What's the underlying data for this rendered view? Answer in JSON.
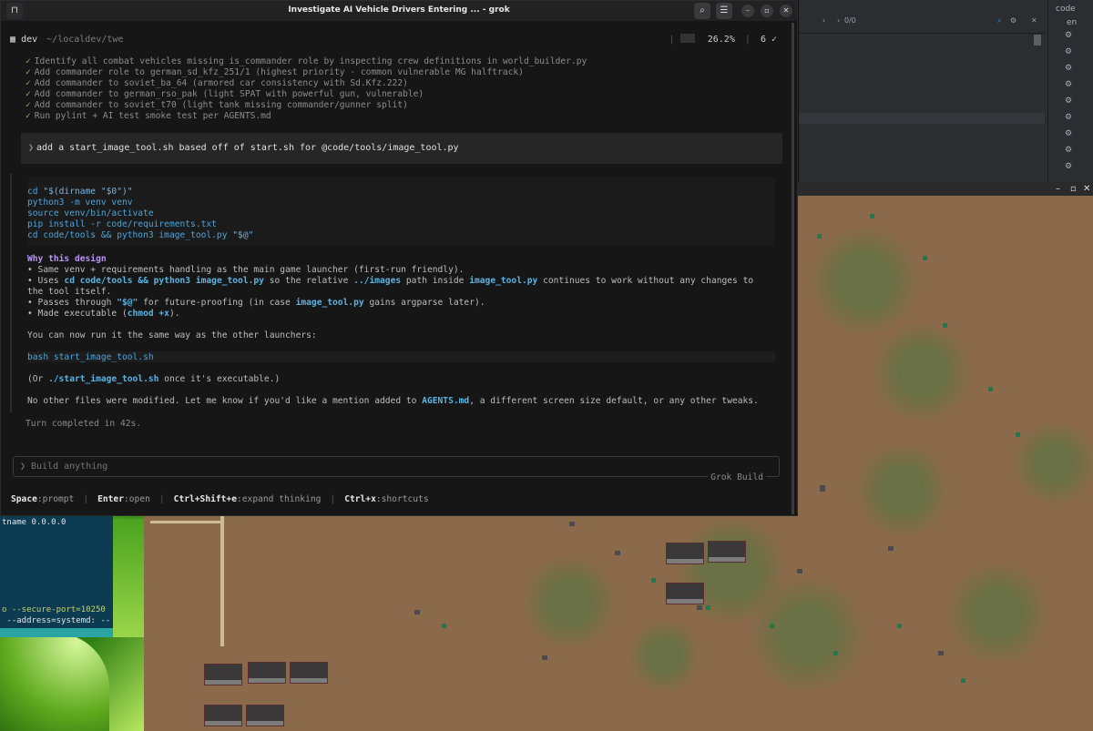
{
  "window": {
    "title": "Investigate AI Vehicle Drivers Entering ... - grok",
    "search_icon": "search-icon",
    "menu_icon": "hamburger-icon"
  },
  "header": {
    "name": "dev",
    "path": "~/localdev/twe",
    "context_percent": "26.2%",
    "done_count": "6 ✓"
  },
  "todos": [
    "Identify all combat vehicles missing is_commander role by inspecting crew definitions in world_builder.py",
    "Add commander role to german_sd_kfz_251/1 (highest priority - common vulnerable MG halftrack)",
    "Add commander to soviet_ba_64 (armored car consistency with Sd.Kfz.222)",
    "Add commander to german_rso_pak (light SPAT with powerful gun, vulnerable)",
    "Add commander to soviet_t70 (light tank missing commander/gunner split)",
    "Run pylint + AI test smoke test per AGENTS.md"
  ],
  "prompt": {
    "caret": "❯",
    "text": "add a start_image_tool.sh based off of start.sh for @code/tools/image_tool.py"
  },
  "code": {
    "l1a": "cd ",
    "l1b": "\"$(dirname \"$0\")\"",
    "l2": "python3 -m venv venv",
    "l3": "source venv/bin/activate",
    "l4": "pip install -r code/requirements.txt",
    "l5a": "cd code/tools && python3 image_tool.py ",
    "l5b": "\"$@\""
  },
  "response": {
    "heading": "Why this design",
    "b1": "• Same venv + requirements handling as the main game launcher (first-run friendly).",
    "b2a": "• Uses ",
    "b2b": "cd code/tools && python3 image_tool.py",
    "b2c": " so the relative ",
    "b2d": "../images",
    "b2e": " path inside ",
    "b2f": "image_tool.py",
    "b2g": " continues to work without any changes to",
    "b2h": "the tool itself.",
    "b3a": "• Passes through ",
    "b3b": "\"$@\"",
    "b3c": " for future-proofing (in case ",
    "b3d": "image_tool.py",
    "b3e": " gains argparse later).",
    "b4a": "• Made executable (",
    "b4b": "chmod +x",
    "b4c": ").",
    "run_line": "You can now run it the same way as the other launchers:",
    "bash_cmd": "bash start_image_tool.sh",
    "or_a": "(Or ",
    "or_b": "./start_image_tool.sh",
    "or_c": " once it's executable.)",
    "final_a": "No other files were modified. Let me know if you'd like a mention added to ",
    "final_b": "AGENTS.md",
    "final_c": ", a different screen size default, or any other tweaks.",
    "turn": "Turn completed in 42s."
  },
  "input": {
    "caret": "❯",
    "placeholder": "Build anything",
    "brand": "Grok Build"
  },
  "shortcuts": [
    {
      "key": "Space",
      "action": "prompt"
    },
    {
      "key": "Enter",
      "action": "open"
    },
    {
      "key": "Ctrl+Shift+e",
      "action": "expand thinking"
    },
    {
      "key": "Ctrl+x",
      "action": "shortcuts"
    }
  ],
  "ide": {
    "find_count": "0/0",
    "tree_root": "code",
    "tree_child": "en"
  },
  "bg_terminal": {
    "l1": "tname 0.0.0.0",
    "l2": "o --secure-port=10250",
    "l3": " --address=systemd: --"
  }
}
